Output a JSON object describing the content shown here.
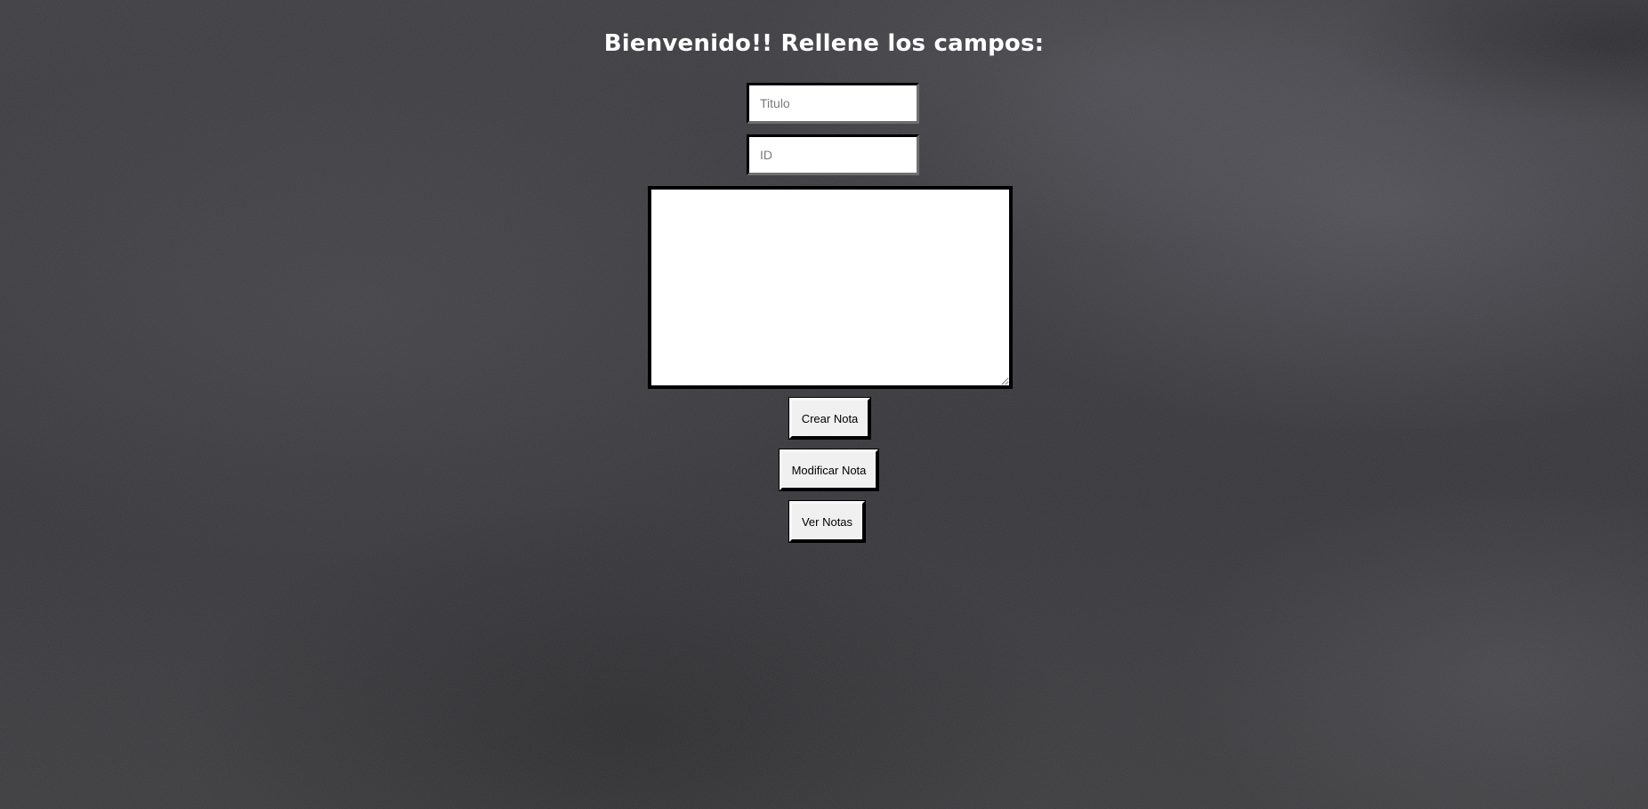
{
  "page": {
    "heading": "Bienvenido!! Rellene los campos:",
    "background_color": "#3a393c"
  },
  "form": {
    "titulo_placeholder": "Titulo",
    "titulo_value": "",
    "id_placeholder": "ID",
    "id_value": "",
    "content_value": ""
  },
  "buttons": {
    "crear": "Crear Nota",
    "modificar": "Modificar Nota",
    "ver": "Ver Notas"
  }
}
